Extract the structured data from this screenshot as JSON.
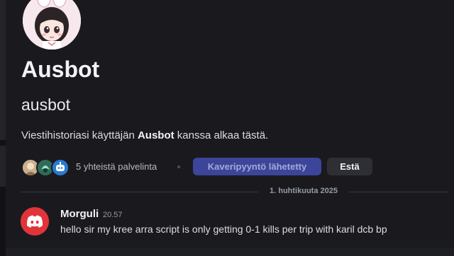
{
  "profile": {
    "display_name": "Ausbot",
    "username": "ausbot",
    "intro_prefix": "Viestihistoriasi käyttäjän ",
    "intro_name": "Ausbot",
    "intro_suffix": " kanssa alkaa tästä."
  },
  "mutuals": {
    "count_text": "5 yhteistä palvelinta",
    "server_icons": [
      "server-icon-1",
      "server-icon-2",
      "server-icon-3"
    ]
  },
  "actions": {
    "friend_request_label": "Kaveripyyntö lähetetty",
    "block_label": "Estä"
  },
  "date_divider": "1. huhtikuuta 2025",
  "messages": [
    {
      "author": "Morguli",
      "time": "20.57",
      "text": "hello sir my kree arra script is only getting 0-1 kills per trip with karil dcb bp",
      "avatar_icon": "discord-logo-icon",
      "avatar_color": "#e0343a"
    }
  ],
  "colors": {
    "background": "#1a1a1e",
    "blurple_button": "#3c4599",
    "secondary_button": "#2e2f35",
    "discord_red": "#e0343a"
  }
}
